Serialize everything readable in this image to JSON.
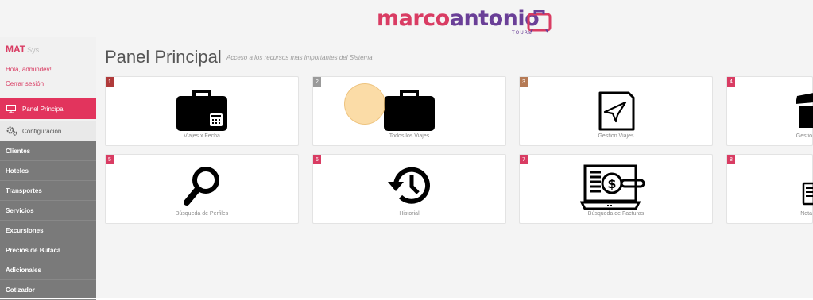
{
  "header": {
    "logo_marco": "marco",
    "logo_antonio": "antonio",
    "logo_tours": "TOURS"
  },
  "sidebar": {
    "brand": "MAT",
    "brand_sub": "Sys",
    "greeting": "Hola, admindev!",
    "logout": "Cerrar sesión",
    "active_item": "Panel Principal",
    "config_item": "Configuracion",
    "submenu": [
      "Clientes",
      "Hoteles",
      "Transportes",
      "Servicios",
      "Excursiones",
      "Precios de Butaca",
      "Adicionales",
      "Cotizador"
    ]
  },
  "main": {
    "title": "Panel Principal",
    "subtitle": "Acceso a los recursos mas importantes del Sistema",
    "tiles": [
      {
        "num": "1",
        "label": "Viajes x Fecha",
        "icon": "calendar-briefcase-icon",
        "badge_color": "#b03a3a"
      },
      {
        "num": "2",
        "label": "Todos los Viajes",
        "icon": "briefcase-icon",
        "badge_color": "#9a9a9a"
      },
      {
        "num": "3",
        "label": "Gestion Viajes",
        "icon": "paper-plane-icon",
        "badge_color": "#b57a55"
      },
      {
        "num": "4",
        "label": "Gestio",
        "icon": "box-icon",
        "badge_color": "#d93c63"
      },
      {
        "num": "5",
        "label": "Búsqueda de Perfiles",
        "icon": "search-icon",
        "badge_color": "#d93c63"
      },
      {
        "num": "6",
        "label": "Historial",
        "icon": "history-icon",
        "badge_color": "#d93c63"
      },
      {
        "num": "7",
        "label": "Búsqueda de Facturas",
        "icon": "invoice-search-icon",
        "badge_color": "#d93c63"
      },
      {
        "num": "8",
        "label": "Nota",
        "icon": "notes-icon",
        "badge_color": "#d93c63"
      }
    ]
  },
  "colors": {
    "accent": "#e2345d",
    "brand_purple": "#6a3f97",
    "submenu_bg": "#7a7a7a"
  }
}
